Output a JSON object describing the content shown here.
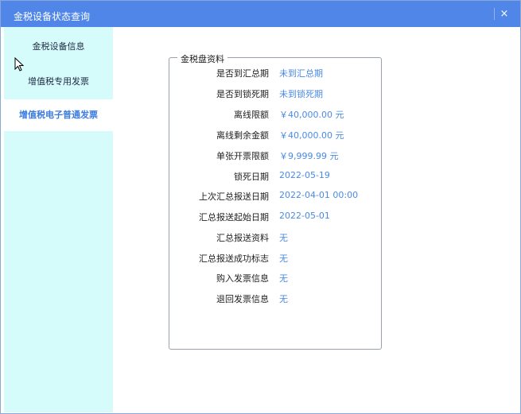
{
  "window": {
    "title": "金税设备状态查询",
    "close_label": "×"
  },
  "sidebar": {
    "items": [
      {
        "label": "金税设备信息"
      },
      {
        "label": "增值税专用发票"
      },
      {
        "label": "增值税电子普通发票"
      }
    ],
    "active_index": 2
  },
  "panel": {
    "legend": "金税盘资料",
    "rows": [
      {
        "label": "是否到汇总期",
        "value": "未到汇总期"
      },
      {
        "label": "是否到锁死期",
        "value": "未到锁死期"
      },
      {
        "label": "离线限额",
        "value": "￥40,000.00 元"
      },
      {
        "label": "离线剩余金额",
        "value": "￥40,000.00 元"
      },
      {
        "label": "单张开票限额",
        "value": "￥9,999.99 元"
      },
      {
        "label": "锁死日期",
        "value": "2022-05-19"
      },
      {
        "label": "上次汇总报送日期",
        "value": "2022-04-01 00:00"
      },
      {
        "label": "汇总报送起始日期",
        "value": "2022-05-01"
      },
      {
        "label": "汇总报送资料",
        "value": "无"
      },
      {
        "label": "汇总报送成功标志",
        "value": "无"
      },
      {
        "label": "购入发票信息",
        "value": "无"
      },
      {
        "label": "退回发票信息",
        "value": "无"
      }
    ]
  },
  "colors": {
    "titlebar": "#4f86e8",
    "sidebar_bg": "#d6fbfb",
    "value_text": "#4a8ae6",
    "active_nav_text": "#3b7be0"
  }
}
